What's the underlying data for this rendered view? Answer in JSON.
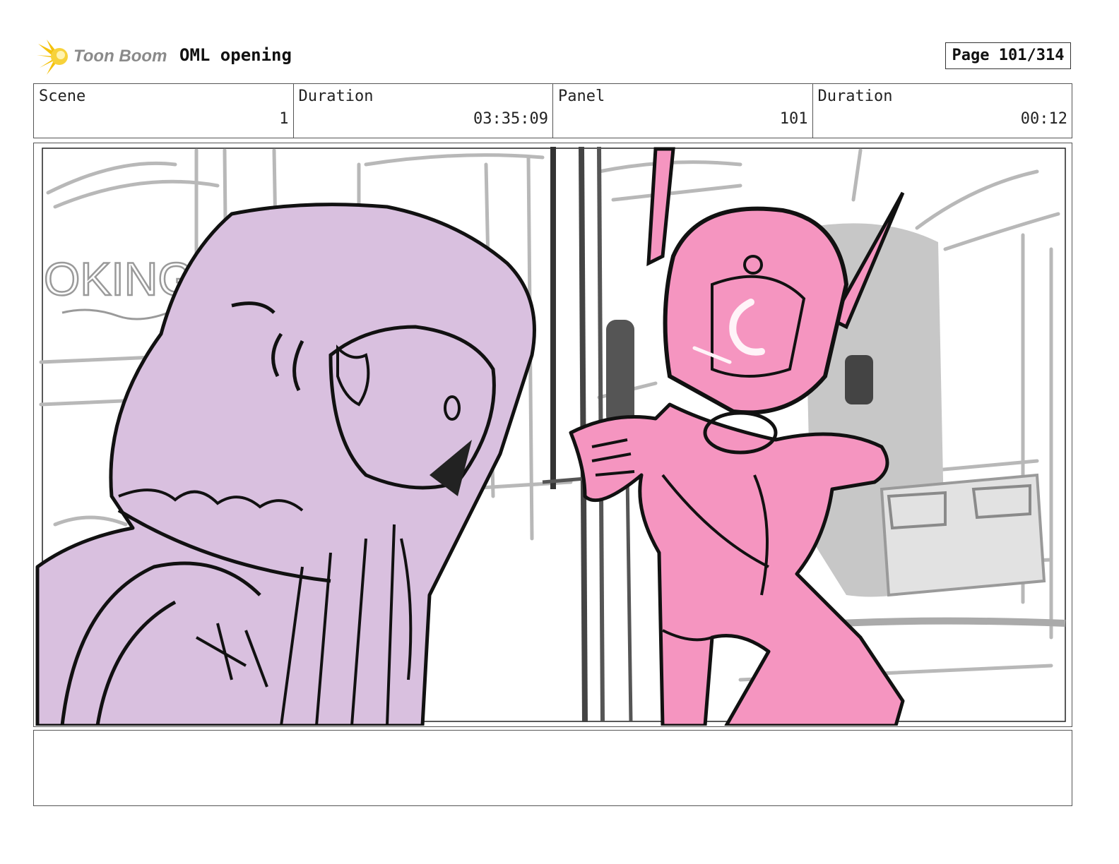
{
  "header": {
    "logo_text": "Toon Boom",
    "project_title": "OML opening",
    "page_label": "Page 101/314"
  },
  "info": {
    "scene_label": "Scene",
    "scene_value": "1",
    "duration_label": "Duration",
    "duration_value": "03:35:09",
    "panel_label": "Panel",
    "panel_value": "101",
    "panel_duration_label": "Duration",
    "panel_duration_value": "00:12"
  },
  "sketch": {
    "background_sign_text": "OKING",
    "colors": {
      "left_character": "#d9c0df",
      "right_robot": "#f595c0",
      "background_gray": "#b8b8b8",
      "line": "#111111"
    }
  },
  "notes": {
    "text": ""
  }
}
